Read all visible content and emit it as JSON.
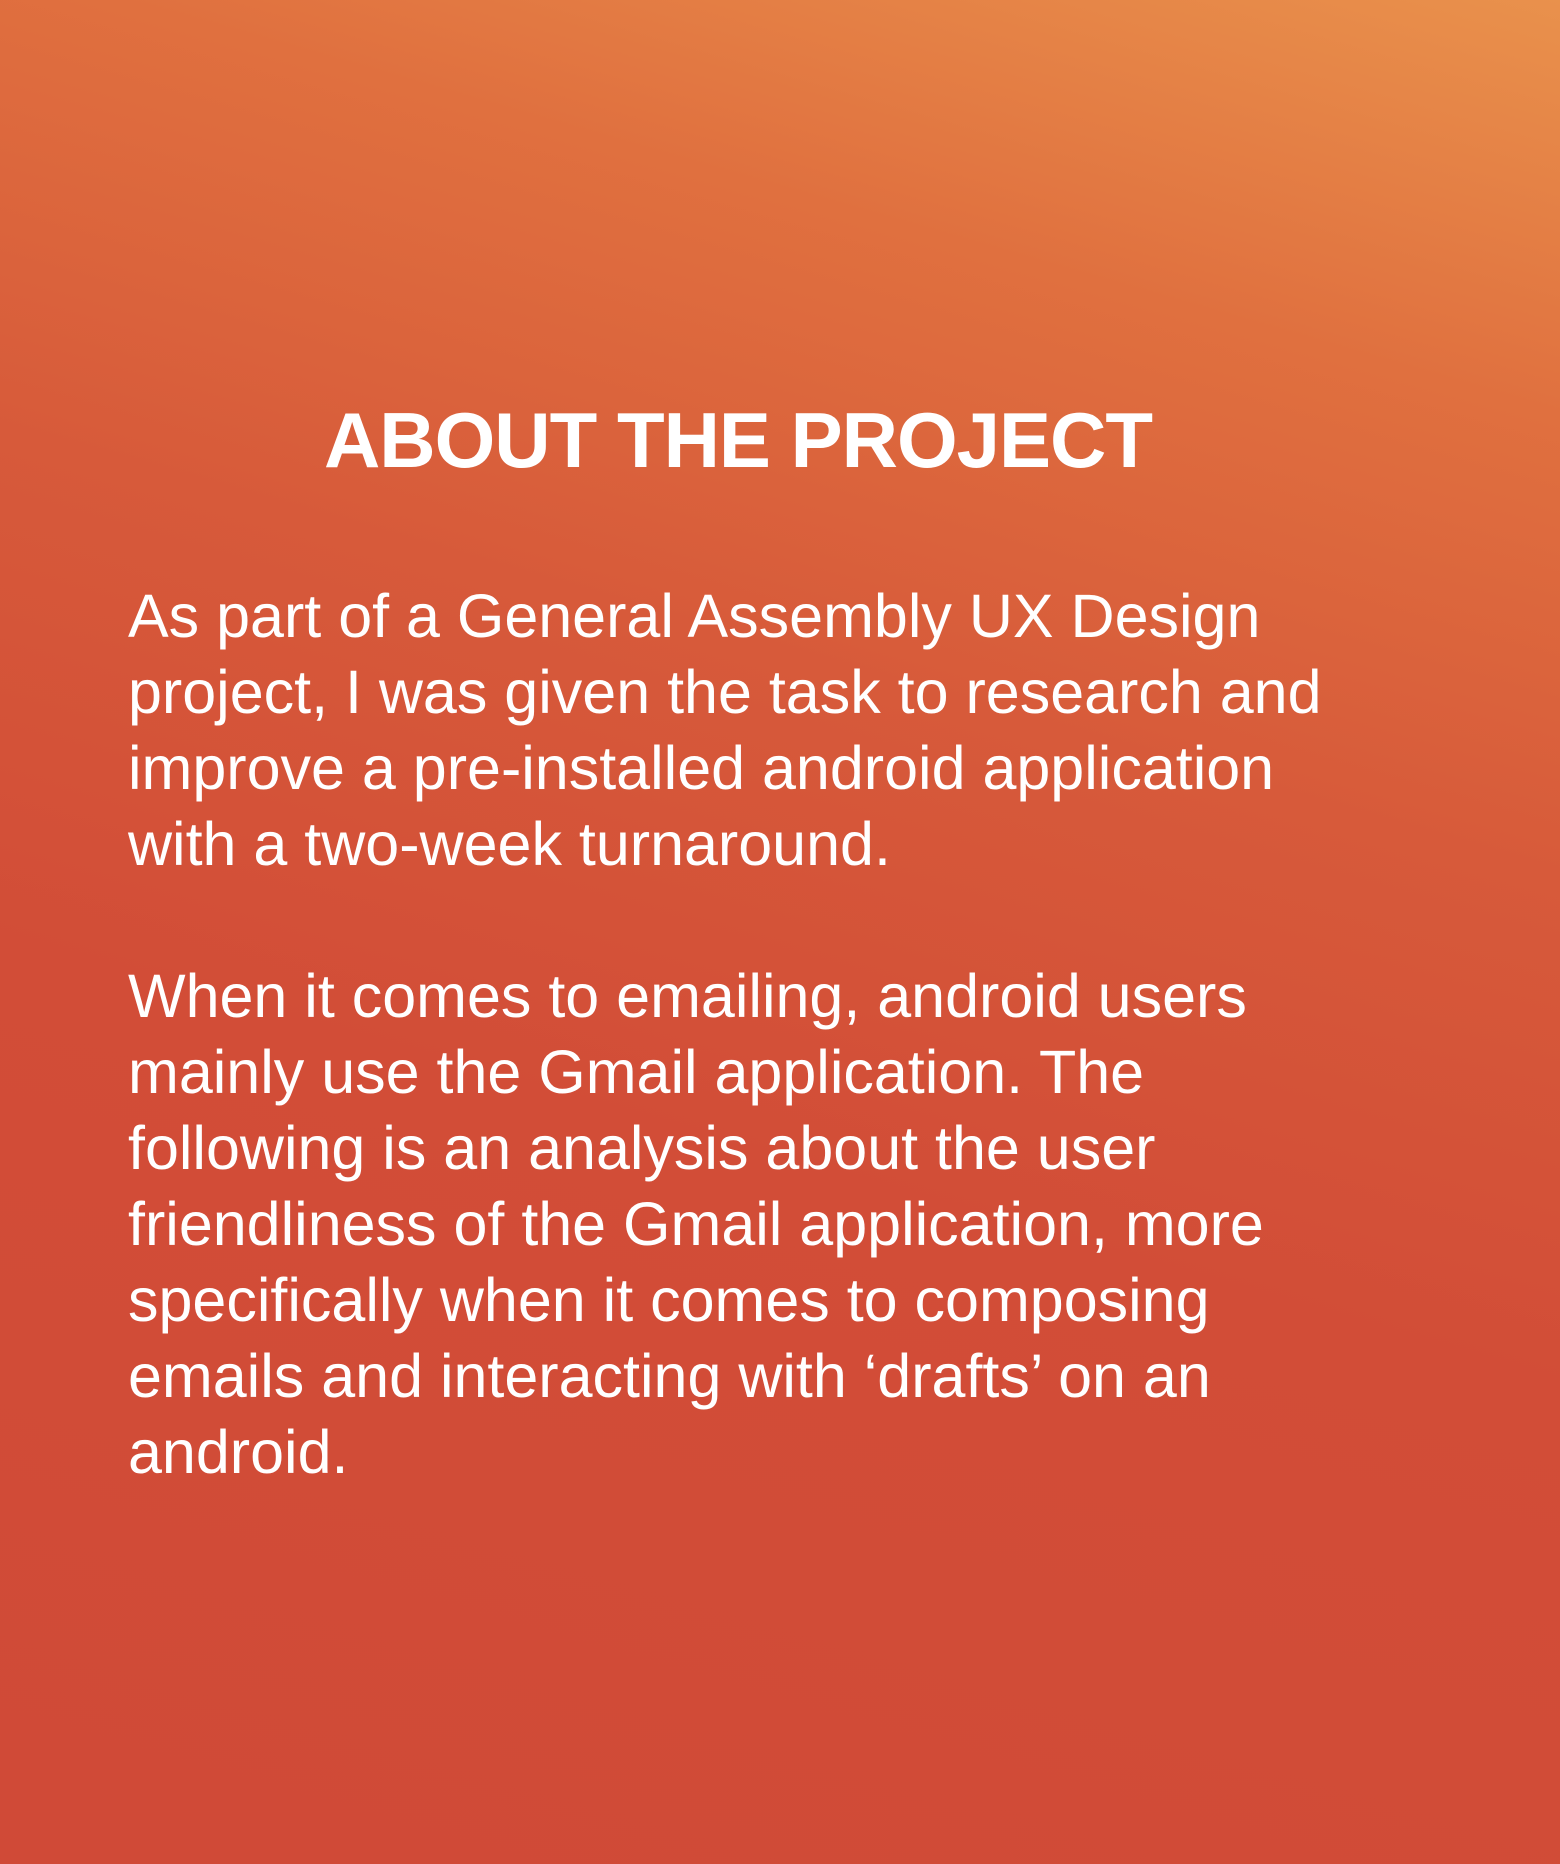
{
  "page": {
    "title": "ABOUT THE PROJECT",
    "paragraphs": [
      {
        "lines": [
          "As part of a General Assembly UX Design",
          "project, I was given the task to research and",
          "improve a pre-installed android application",
          "with a two-week turnaround."
        ]
      },
      {
        "lines": [
          "When it comes to emailing, android users",
          "mainly use the Gmail application. The",
          "following is an analysis about the user",
          "friendliness of the Gmail application, more",
          "specifically when it comes to composing",
          "emails and interacting with ‘drafts’ on an",
          "android."
        ]
      }
    ],
    "colors": {
      "background_top": "#e9914c",
      "background_bottom": "#d04a37",
      "text": "#ffffff"
    }
  }
}
